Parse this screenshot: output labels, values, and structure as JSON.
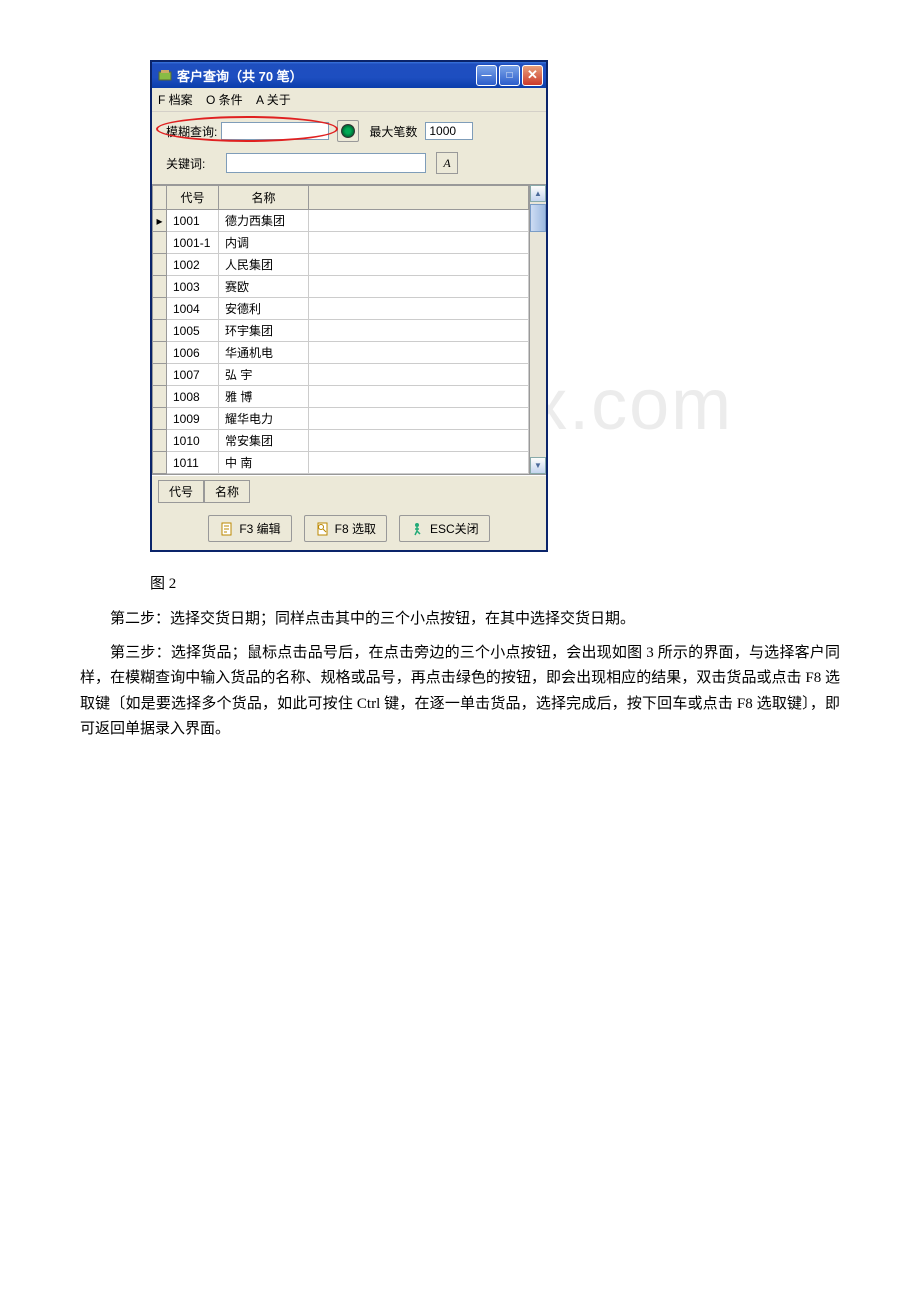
{
  "watermark": "www.bdocx.com",
  "window": {
    "title": "客户查询（共 70 笔）",
    "menubar": {
      "file": "F 档案",
      "criteria": "O 条件",
      "about": "A 关于"
    },
    "search": {
      "fuzzy_label": "模糊查询:",
      "fuzzy_value": "",
      "max_label": "最大笔数",
      "max_value": "1000",
      "keyword_label": "关键词:",
      "keyword_value": "",
      "a_button": "A"
    },
    "table": {
      "headers": {
        "code": "代号",
        "name": "名称"
      },
      "rows": [
        {
          "code": "1001",
          "name": "德力西集团"
        },
        {
          "code": "1001-1",
          "name": "内调"
        },
        {
          "code": "1002",
          "name": "人民集团"
        },
        {
          "code": "1003",
          "name": "赛欧"
        },
        {
          "code": "1004",
          "name": "安德利"
        },
        {
          "code": "1005",
          "name": "环宇集团"
        },
        {
          "code": "1006",
          "name": "华通机电"
        },
        {
          "code": "1007",
          "name": "弘 宇"
        },
        {
          "code": "1008",
          "name": "雅 博"
        },
        {
          "code": "1009",
          "name": "耀华电力"
        },
        {
          "code": "1010",
          "name": "常安集团"
        },
        {
          "code": "1011",
          "name": "中 南"
        }
      ]
    },
    "status": {
      "code_label": "代号",
      "name_label": "名称"
    },
    "buttons": {
      "edit": "F3 编辑",
      "select": "F8 选取",
      "close": "ESC关闭"
    }
  },
  "caption": "图 2",
  "step2": "第二步：选择交货日期；同样点击其中的三个小点按钮，在其中选择交货日期。",
  "step3": "第三步：选择货品；鼠标点击品号后，在点击旁边的三个小点按钮，会出现如图 3 所示的界面，与选择客户同样，在模糊查询中输入货品的名称、规格或品号，再点击绿色的按钮，即会出现相应的结果，双击货品或点击 F8 选取键〔如是要选择多个货品，如此可按住 Ctrl 键，在逐一单击货品，选择完成后，按下回车或点击 F8 选取键〕，即可返回单据录入界面。"
}
